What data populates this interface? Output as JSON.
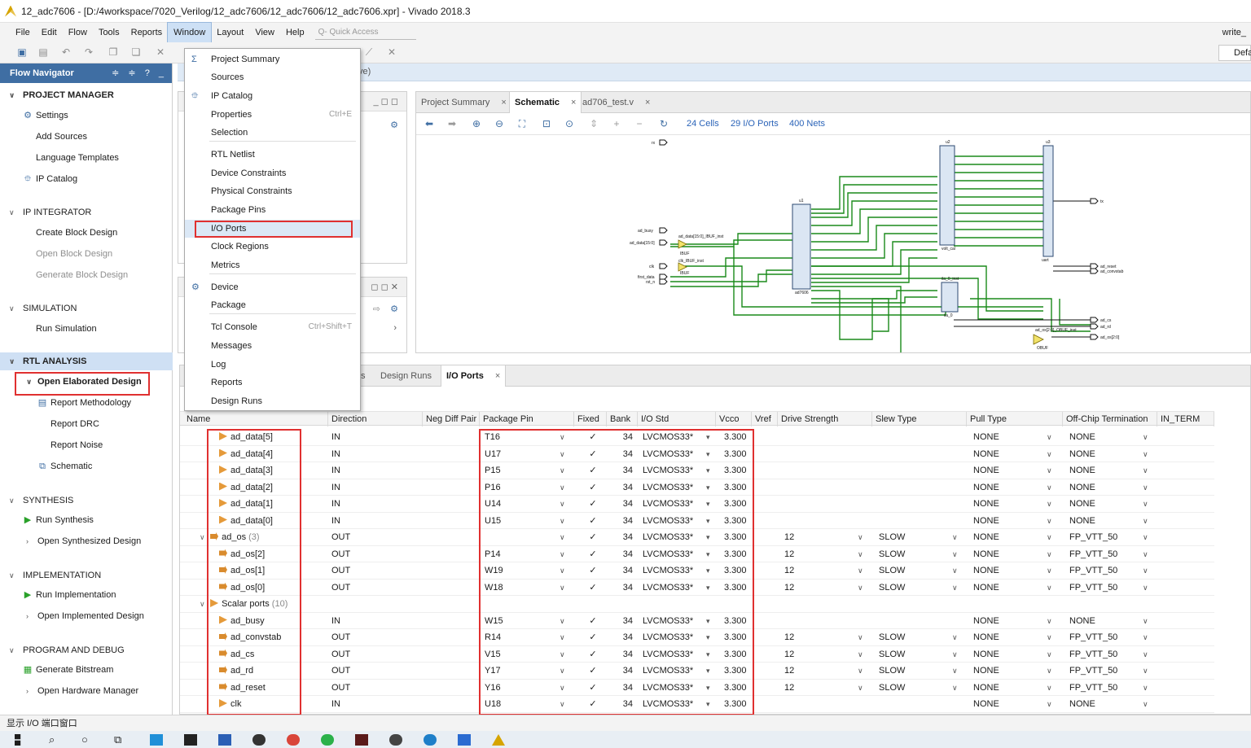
{
  "window": {
    "title": "12_adc7606 - [D:/4workspace/7020_Verilog/12_adc7606/12_adc7606/12_adc7606.xpr] - Vivado 2018.3"
  },
  "menubar": {
    "items": [
      "File",
      "Edit",
      "Flow",
      "Tools",
      "Reports",
      "Window",
      "Layout",
      "View",
      "Help"
    ],
    "quick_access_placeholder": "Q- Quick Access",
    "right_label": "write_"
  },
  "toolbar": {
    "layout_select": "Defa"
  },
  "breadcrumb": {
    "text": "ve)"
  },
  "flow_navigator": {
    "title": "Flow Navigator",
    "header_icons": "≑ ≑ ? _",
    "sections": [
      {
        "label": "PROJECT MANAGER",
        "items": [
          "Settings",
          "Add Sources",
          "Language Templates",
          "IP Catalog"
        ]
      },
      {
        "label": "IP INTEGRATOR",
        "items": [
          "Create Block Design",
          "Open Block Design",
          "Generate Block Design"
        ]
      },
      {
        "label": "SIMULATION",
        "items": [
          "Run Simulation"
        ]
      },
      {
        "label": "RTL ANALYSIS",
        "items": [
          "Open Elaborated Design",
          "Report Methodology",
          "Report DRC",
          "Report Noise",
          "Schematic"
        ]
      },
      {
        "label": "SYNTHESIS",
        "items": [
          "Run Synthesis",
          "Open Synthesized Design"
        ]
      },
      {
        "label": "IMPLEMENTATION",
        "items": [
          "Run Implementation",
          "Open Implemented Design"
        ]
      },
      {
        "label": "PROGRAM AND DEBUG",
        "items": [
          "Generate Bitstream",
          "Open Hardware Manager"
        ]
      }
    ]
  },
  "window_menu": {
    "items": [
      {
        "label": "Project Summary",
        "shortcut": "",
        "icon": "sigma-icon"
      },
      {
        "label": "Sources",
        "shortcut": ""
      },
      {
        "label": "IP Catalog",
        "shortcut": "",
        "icon": "ip-plug-icon"
      },
      {
        "label": "Properties",
        "shortcut": "Ctrl+E"
      },
      {
        "label": "Selection",
        "shortcut": ""
      },
      {
        "label": "RTL Netlist",
        "shortcut": ""
      },
      {
        "label": "Device Constraints",
        "shortcut": ""
      },
      {
        "label": "Physical Constraints",
        "shortcut": ""
      },
      {
        "label": "Package Pins",
        "shortcut": ""
      },
      {
        "label": "I/O Ports",
        "shortcut": ""
      },
      {
        "label": "Clock Regions",
        "shortcut": ""
      },
      {
        "label": "Metrics",
        "shortcut": ""
      },
      {
        "label": "Device",
        "shortcut": "",
        "icon": "device-chip-icon"
      },
      {
        "label": "Package",
        "shortcut": ""
      },
      {
        "label": "Tcl Console",
        "shortcut": "Ctrl+Shift+T"
      },
      {
        "label": "Messages",
        "shortcut": ""
      },
      {
        "label": "Log",
        "shortcut": ""
      },
      {
        "label": "Reports",
        "shortcut": ""
      },
      {
        "label": "Design Runs",
        "shortcut": ""
      }
    ]
  },
  "schematic_panel": {
    "tabs": [
      "Project Summary",
      "Schematic",
      "ad706_test.v"
    ],
    "close_glyph": "×",
    "cells_link": "24 Cells",
    "io_ports_link": "29 I/O Ports",
    "nets_link": "400 Nets",
    "labels": {
      "rx": "rx",
      "tx": "tx",
      "ad_busy": "ad_busy",
      "ad_data": "ad_data[15:0]",
      "clk": "clk",
      "first_data": "first_data",
      "rst_n": "rst_n",
      "ad_reset": "ad_reset",
      "ad_convstab": "ad_convstab",
      "ad_cs": "ad_cs",
      "ad_rd": "ad_rd",
      "ad_os": "ad_os[2:0]",
      "ibuf1": "ad_data[15:0]_IBUF_inst",
      "ibuf2": "clk_IBUF_inst",
      "ibuf": "IBUF",
      "obuf_inst": "ad_os[2:0]_OBUF_inst",
      "obuf": "OBUF",
      "u1": "u1",
      "u1_name": "ad7606",
      "u2": "u2",
      "u2_name": "volt_cal",
      "u3": "u3",
      "u3_name": "uart",
      "u4": "ila_0_inst",
      "u4_name": "ila_0"
    }
  },
  "bottom_panel": {
    "tabs": [
      "s",
      "Design Runs",
      "I/O Ports"
    ],
    "close_glyph": "×",
    "columns": [
      "Name",
      "Direction",
      "Neg Diff Pair",
      "Package Pin",
      "Fixed",
      "Bank",
      "I/O Std",
      "Vcco",
      "Vref",
      "Drive Strength",
      "Slew Type",
      "Pull Type",
      "Off-Chip Termination",
      "IN_TERM"
    ],
    "rows": [
      {
        "name": "ad_data[5]",
        "dir": "IN",
        "pin": "T16",
        "fixed": "✓",
        "bank": "34",
        "iostd": "LVCMOS33*",
        "vcco": "3.300",
        "drive": "",
        "slew": "",
        "pull": "NONE",
        "term": "NONE"
      },
      {
        "name": "ad_data[4]",
        "dir": "IN",
        "pin": "U17",
        "fixed": "✓",
        "bank": "34",
        "iostd": "LVCMOS33*",
        "vcco": "3.300",
        "drive": "",
        "slew": "",
        "pull": "NONE",
        "term": "NONE"
      },
      {
        "name": "ad_data[3]",
        "dir": "IN",
        "pin": "P15",
        "fixed": "✓",
        "bank": "34",
        "iostd": "LVCMOS33*",
        "vcco": "3.300",
        "drive": "",
        "slew": "",
        "pull": "NONE",
        "term": "NONE"
      },
      {
        "name": "ad_data[2]",
        "dir": "IN",
        "pin": "P16",
        "fixed": "✓",
        "bank": "34",
        "iostd": "LVCMOS33*",
        "vcco": "3.300",
        "drive": "",
        "slew": "",
        "pull": "NONE",
        "term": "NONE"
      },
      {
        "name": "ad_data[1]",
        "dir": "IN",
        "pin": "U14",
        "fixed": "✓",
        "bank": "34",
        "iostd": "LVCMOS33*",
        "vcco": "3.300",
        "drive": "",
        "slew": "",
        "pull": "NONE",
        "term": "NONE"
      },
      {
        "name": "ad_data[0]",
        "dir": "IN",
        "pin": "U15",
        "fixed": "✓",
        "bank": "34",
        "iostd": "LVCMOS33*",
        "vcco": "3.300",
        "drive": "",
        "slew": "",
        "pull": "NONE",
        "term": "NONE"
      },
      {
        "name": "ad_os",
        "count": "(3)",
        "group": true,
        "dir": "OUT",
        "pin": "",
        "fixed": "✓",
        "bank": "34",
        "iostd": "LVCMOS33*",
        "vcco": "3.300",
        "drive": "12",
        "slew": "SLOW",
        "pull": "NONE",
        "term": "FP_VTT_50"
      },
      {
        "name": "ad_os[2]",
        "dir": "OUT",
        "pin": "P14",
        "fixed": "✓",
        "bank": "34",
        "iostd": "LVCMOS33*",
        "vcco": "3.300",
        "drive": "12",
        "slew": "SLOW",
        "pull": "NONE",
        "term": "FP_VTT_50"
      },
      {
        "name": "ad_os[1]",
        "dir": "OUT",
        "pin": "W19",
        "fixed": "✓",
        "bank": "34",
        "iostd": "LVCMOS33*",
        "vcco": "3.300",
        "drive": "12",
        "slew": "SLOW",
        "pull": "NONE",
        "term": "FP_VTT_50"
      },
      {
        "name": "ad_os[0]",
        "dir": "OUT",
        "pin": "W18",
        "fixed": "✓",
        "bank": "34",
        "iostd": "LVCMOS33*",
        "vcco": "3.300",
        "drive": "12",
        "slew": "SLOW",
        "pull": "NONE",
        "term": "FP_VTT_50"
      },
      {
        "name": "Scalar ports",
        "count": "(10)",
        "group": true,
        "dir": "",
        "pin": "",
        "fixed": "",
        "bank": "",
        "iostd": "",
        "vcco": "",
        "drive": "",
        "slew": "",
        "pull": "",
        "term": ""
      },
      {
        "name": "ad_busy",
        "dir": "IN",
        "pin": "W15",
        "fixed": "✓",
        "bank": "34",
        "iostd": "LVCMOS33*",
        "vcco": "3.300",
        "drive": "",
        "slew": "",
        "pull": "NONE",
        "term": "NONE"
      },
      {
        "name": "ad_convstab",
        "dir": "OUT",
        "pin": "R14",
        "fixed": "✓",
        "bank": "34",
        "iostd": "LVCMOS33*",
        "vcco": "3.300",
        "drive": "12",
        "slew": "SLOW",
        "pull": "NONE",
        "term": "FP_VTT_50"
      },
      {
        "name": "ad_cs",
        "dir": "OUT",
        "pin": "V15",
        "fixed": "✓",
        "bank": "34",
        "iostd": "LVCMOS33*",
        "vcco": "3.300",
        "drive": "12",
        "slew": "SLOW",
        "pull": "NONE",
        "term": "FP_VTT_50"
      },
      {
        "name": "ad_rd",
        "dir": "OUT",
        "pin": "Y17",
        "fixed": "✓",
        "bank": "34",
        "iostd": "LVCMOS33*",
        "vcco": "3.300",
        "drive": "12",
        "slew": "SLOW",
        "pull": "NONE",
        "term": "FP_VTT_50"
      },
      {
        "name": "ad_reset",
        "dir": "OUT",
        "pin": "Y16",
        "fixed": "✓",
        "bank": "34",
        "iostd": "LVCMOS33*",
        "vcco": "3.300",
        "drive": "12",
        "slew": "SLOW",
        "pull": "NONE",
        "term": "FP_VTT_50"
      },
      {
        "name": "clk",
        "dir": "IN",
        "pin": "U18",
        "fixed": "✓",
        "bank": "34",
        "iostd": "LVCMOS33*",
        "vcco": "3.300",
        "drive": "",
        "slew": "",
        "pull": "NONE",
        "term": "NONE"
      }
    ]
  },
  "statusbar": {
    "text": "显示 I/O 端口窗口"
  },
  "colors": {
    "accent": "#3f6ea3",
    "highlight_box": "#e03030",
    "net_green": "#1a8a1a",
    "link_blue": "#2a63b8"
  }
}
